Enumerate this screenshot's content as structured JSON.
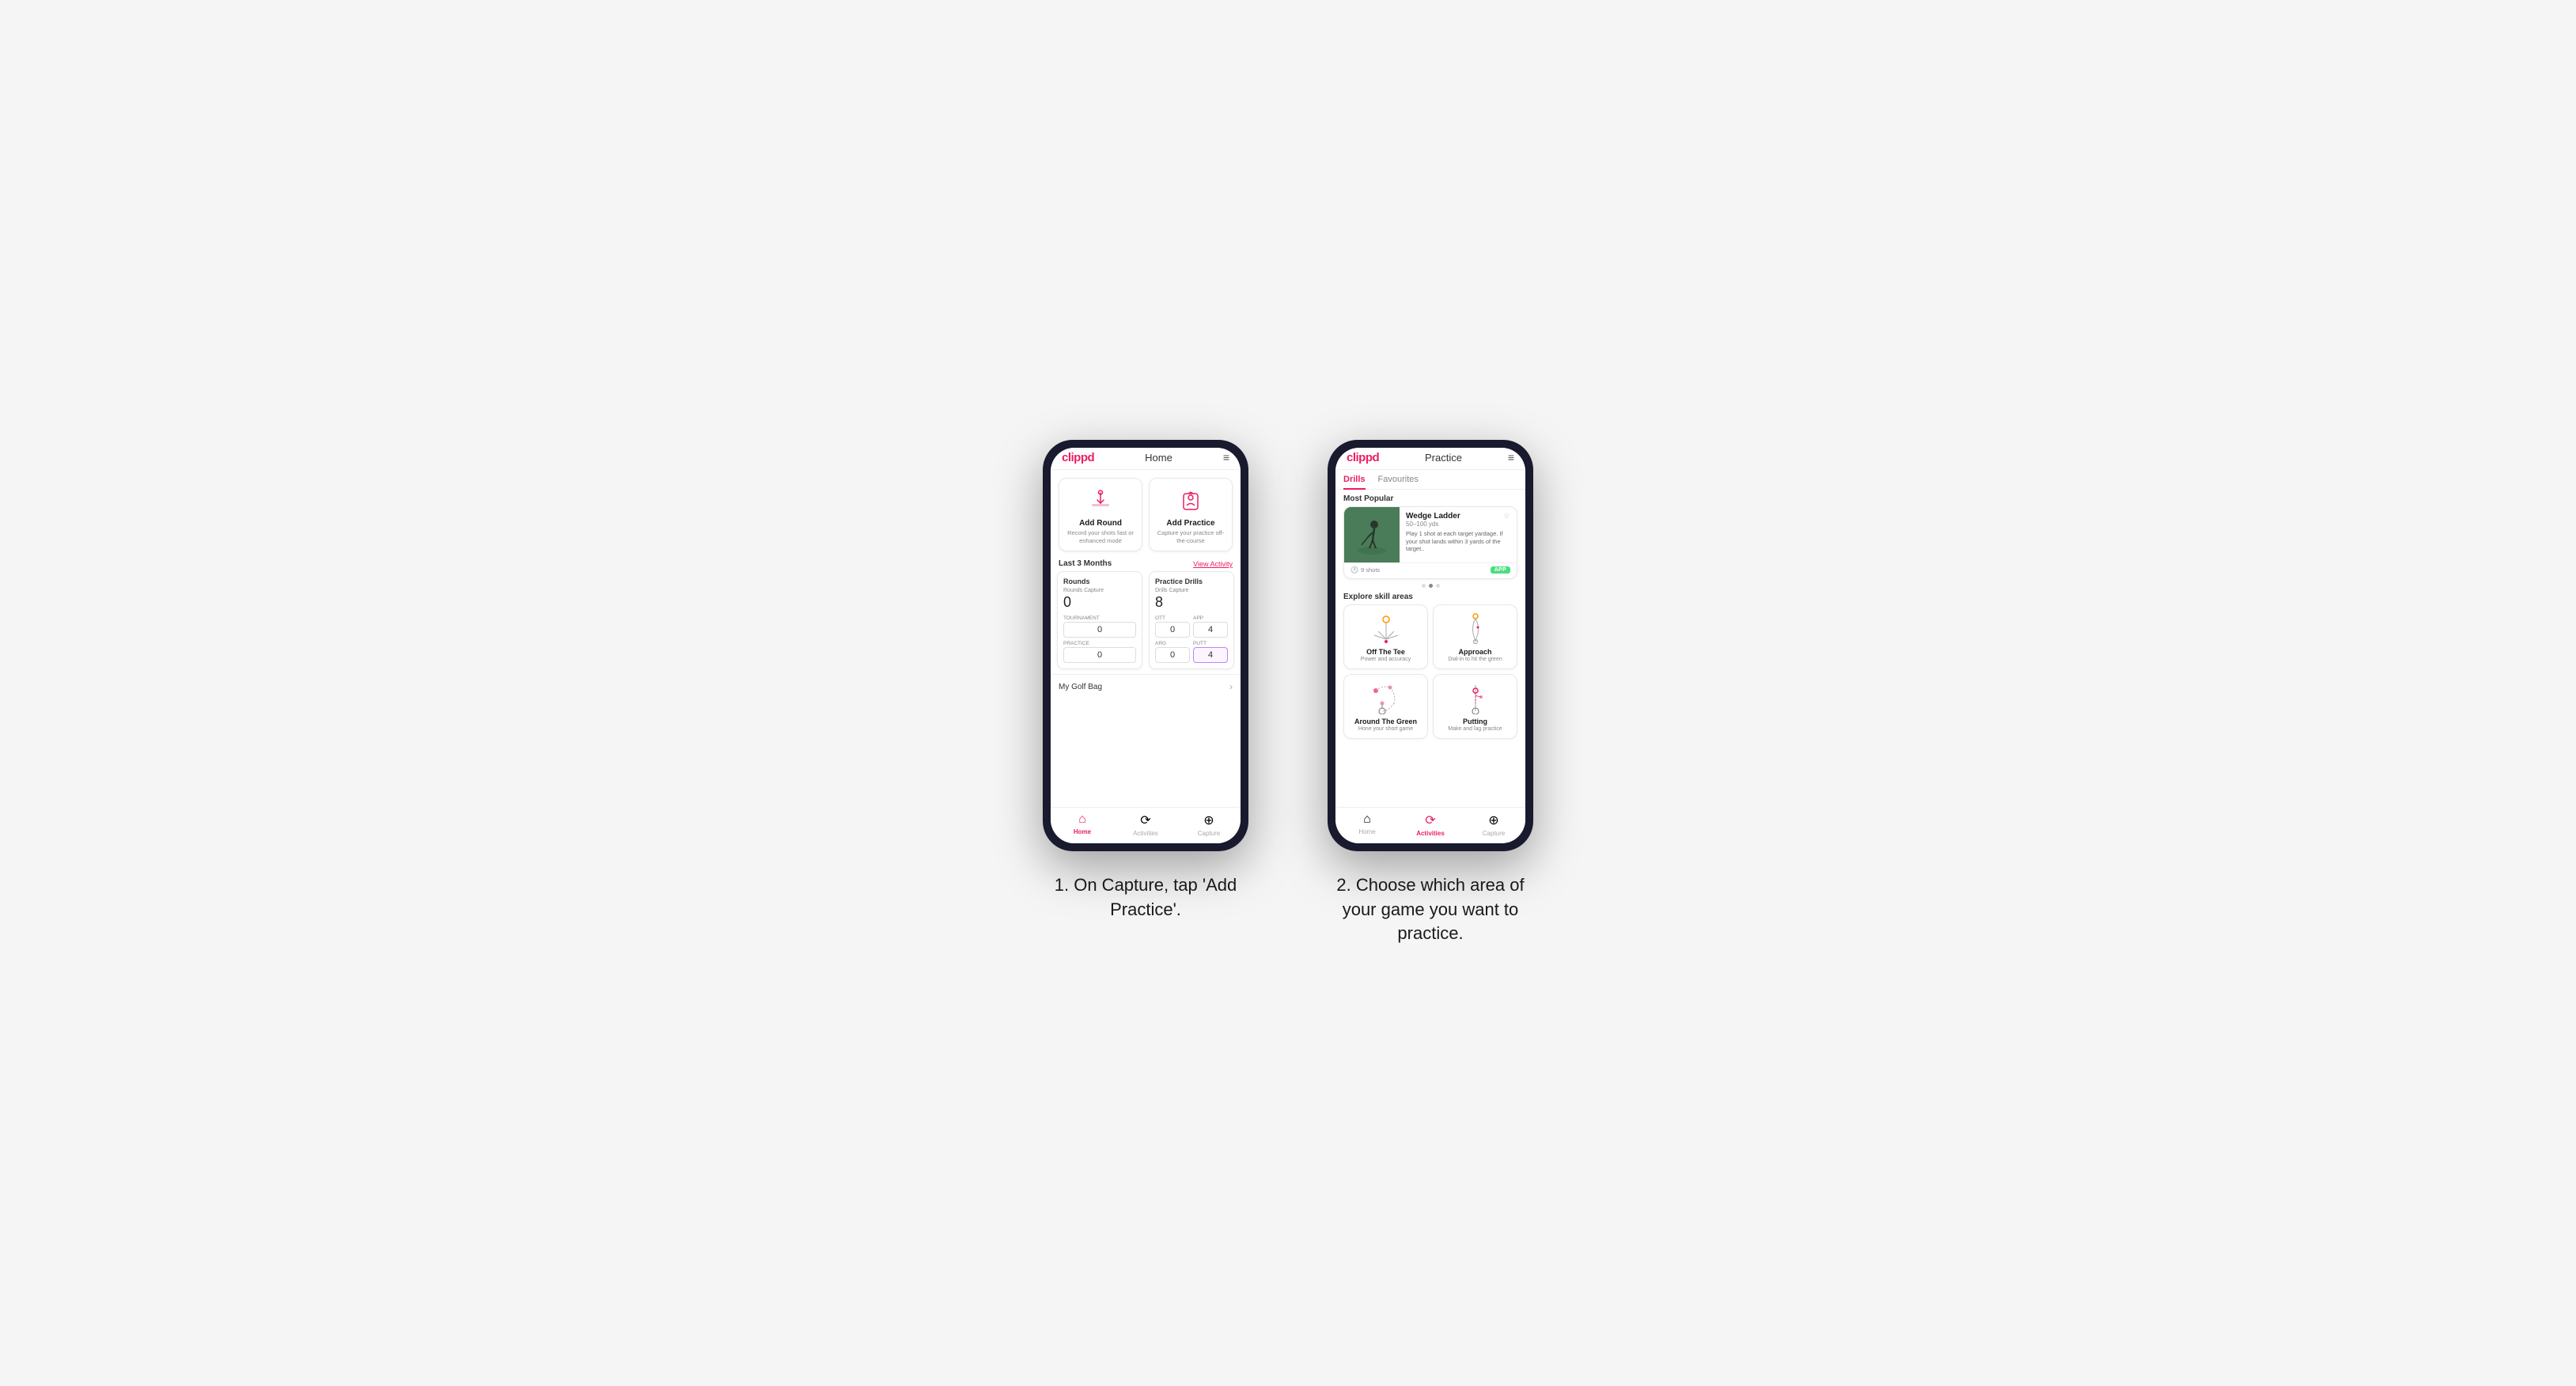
{
  "phone1": {
    "logo": "clippd",
    "nav_title": "Home",
    "action_cards": [
      {
        "id": "add-round",
        "title": "Add Round",
        "subtitle": "Record your shots fast or enhanced mode"
      },
      {
        "id": "add-practice",
        "title": "Add Practice",
        "subtitle": "Capture your practice off-the-course"
      }
    ],
    "last3months_label": "Last 3 Months",
    "view_activity_label": "View Activity",
    "rounds_section": {
      "title": "Rounds",
      "rounds_capture_label": "Rounds Capture",
      "rounds_value": "0",
      "tournament_label": "Tournament",
      "tournament_value": "0",
      "practice_label": "Practice",
      "practice_value": "0"
    },
    "drills_section": {
      "title": "Practice Drills",
      "drills_capture_label": "Drills Capture",
      "drills_value": "8",
      "ott_label": "OTT",
      "ott_value": "0",
      "app_label": "APP",
      "app_value": "4",
      "arg_label": "ARG",
      "arg_value": "0",
      "putt_label": "PUTT",
      "putt_value": "4"
    },
    "golf_bag_label": "My Golf Bag",
    "tabs": [
      {
        "id": "home",
        "label": "Home",
        "icon": "🏠",
        "active": true
      },
      {
        "id": "activities",
        "label": "Activities",
        "icon": "🔁",
        "active": false
      },
      {
        "id": "capture",
        "label": "Capture",
        "icon": "➕",
        "active": false
      }
    ]
  },
  "phone2": {
    "logo": "clippd",
    "nav_title": "Practice",
    "tab_drills": "Drills",
    "tab_favourites": "Favourites",
    "most_popular_label": "Most Popular",
    "featured": {
      "title": "Wedge Ladder",
      "yardage": "50–100 yds",
      "description": "Play 1 shot at each target yardage. If your shot lands within 3 yards of the target..",
      "shots_label": "9 shots",
      "badge": "APP"
    },
    "dots": [
      {
        "active": false
      },
      {
        "active": true
      },
      {
        "active": false
      }
    ],
    "explore_label": "Explore skill areas",
    "skill_areas": [
      {
        "id": "off-the-tee",
        "name": "Off The Tee",
        "desc": "Power and accuracy"
      },
      {
        "id": "approach",
        "name": "Approach",
        "desc": "Dial-in to hit the green"
      },
      {
        "id": "around-the-green",
        "name": "Around The Green",
        "desc": "Hone your short game"
      },
      {
        "id": "putting",
        "name": "Putting",
        "desc": "Make and lag practice"
      }
    ],
    "tabs": [
      {
        "id": "home",
        "label": "Home",
        "icon": "🏠",
        "active": false
      },
      {
        "id": "activities",
        "label": "Activities",
        "icon": "🔁",
        "active": true
      },
      {
        "id": "capture",
        "label": "Capture",
        "icon": "➕",
        "active": false
      }
    ]
  },
  "caption1": "1. On Capture, tap 'Add Practice'.",
  "caption2": "2. Choose which area of your game you want to practice."
}
